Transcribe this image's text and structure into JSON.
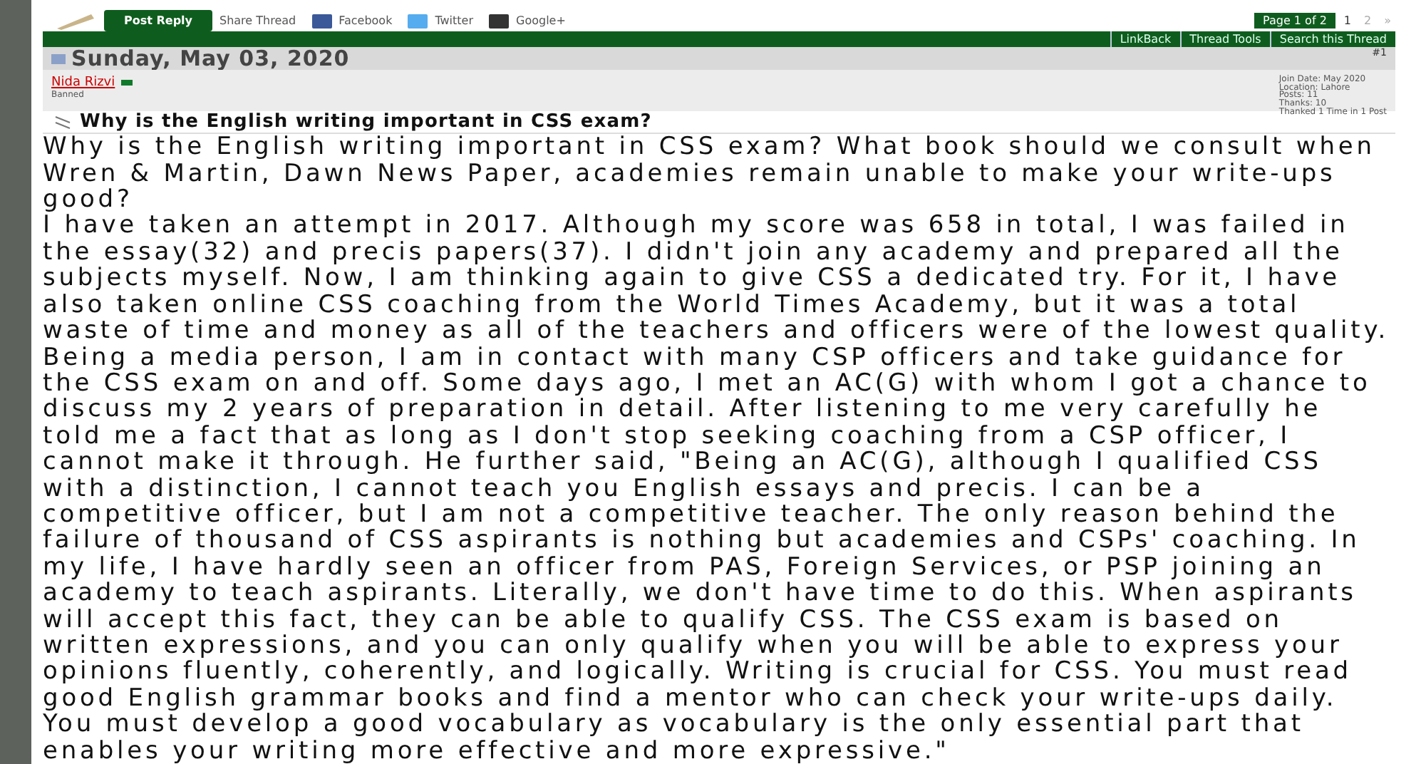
{
  "toolbar": {
    "post_reply": "Post Reply",
    "share_label": "Share Thread",
    "share_links": [
      "Facebook",
      "Twitter",
      "Google+"
    ]
  },
  "pagination": {
    "label": "Page 1 of 2",
    "pages": [
      {
        "label": "1",
        "selected": true
      },
      {
        "label": "2",
        "selected": false
      }
    ],
    "next": "»"
  },
  "thread_tools": [
    "LinkBack",
    "Thread Tools",
    "Search this Thread"
  ],
  "post": {
    "date": "Sunday, May 03, 2020",
    "number": "#1",
    "author": "Nida Rizvi",
    "author_online": true,
    "author_status": "Banned",
    "user_info": [
      "Join Date: May 2020",
      "Location: Lahore",
      "Posts: 11",
      "Thanks: 10",
      "Thanked 1 Time in 1 Post"
    ],
    "title": "Why is the English writing important in CSS exam?",
    "paragraphs": [
      "Why is the English writing important in CSS exam? What book should we consult when Wren & Martin, Dawn News Paper, academies remain unable to make your write-ups good?",
      "I have taken an attempt in 2017. Although my score was 658 in total, I was failed in the essay(32) and precis papers(37). I didn't join any academy and prepared all the subjects myself. Now, I am thinking again to give CSS a dedicated try. For it, I have also taken online CSS coaching from the World Times Academy, but it was a total waste of time and money as all of the teachers and officers were of the lowest quality. Being a media person, I am in contact with many CSP officers and take guidance for the CSS exam on and off. Some days ago, I met an AC(G) with whom I got a chance to discuss my 2 years of preparation in detail. After listening to me very carefully he told me a fact that as long as I don't stop seeking coaching from a CSP officer, I cannot make it through. He further said, \"Being an AC(G), although I qualified CSS with a distinction, I cannot teach you English essays and precis. I can be a competitive officer, but I am not a competitive teacher. The only reason behind the failure of thousand of CSS aspirants is nothing but academies and CSPs' coaching. In my life, I have hardly seen an officer from PAS, Foreign Services, or PSP joining an academy to teach aspirants. Literally, we don't have time to do this. When aspirants will accept this fact, they can be able to qualify CSS. The CSS exam is based on written expressions, and you can only qualify when you will be able to express your opinions fluently, coherently, and logically. Writing is crucial for CSS. You must read good English grammar books and find a mentor who can check your write-ups daily. You must develop a good vocabulary as vocabulary is the only essential part that enables your writing more effective and more expressive.\""
    ]
  }
}
